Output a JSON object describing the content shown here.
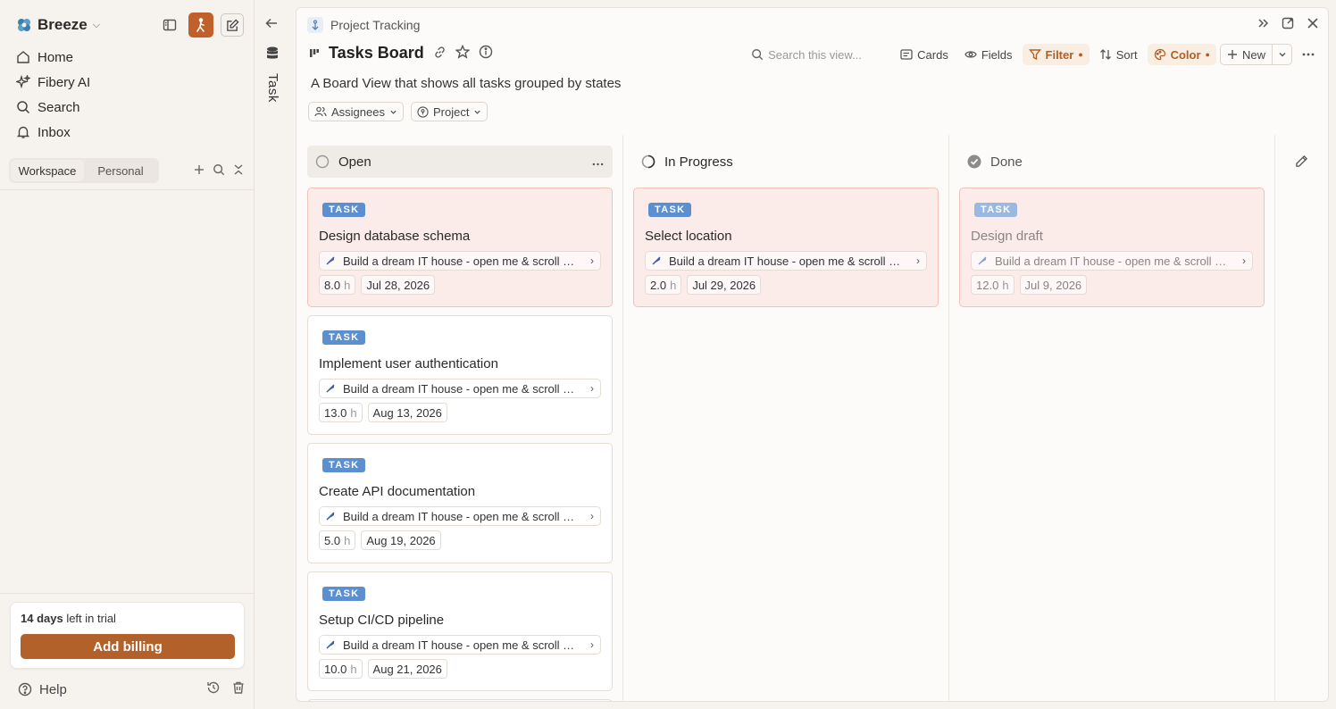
{
  "workspace": {
    "name": "Breeze"
  },
  "nav": [
    {
      "label": "Home",
      "icon": "home-icon"
    },
    {
      "label": "Fibery AI",
      "icon": "sparkle-icon"
    },
    {
      "label": "Search",
      "icon": "search-icon"
    },
    {
      "label": "Inbox",
      "icon": "bell-icon"
    }
  ],
  "sidebar_tabs": {
    "workspace": "Workspace",
    "personal": "Personal"
  },
  "trial": {
    "days": "14 days",
    "suffix": " left in trial",
    "button": "Add billing"
  },
  "help": "Help",
  "strip": {
    "label": "Task"
  },
  "breadcrumb": "Project Tracking",
  "view": {
    "title": "Tasks Board",
    "description": "A Board View that shows all tasks grouped by states",
    "search_placeholder": "Search this view...",
    "toolbar": {
      "cards": "Cards",
      "fields": "Fields",
      "filter": "Filter",
      "sort": "Sort",
      "color": "Color",
      "new": "New"
    },
    "filters": {
      "assignees": "Assignees",
      "project": "Project"
    }
  },
  "columns": [
    {
      "name": "Open",
      "icon": "circle-open-icon"
    },
    {
      "name": "In Progress",
      "icon": "progress-icon"
    },
    {
      "name": "Done",
      "icon": "check-circle-icon"
    }
  ],
  "cards": [
    {
      "badge": "TASK",
      "title": "Design database schema",
      "project": "Build a dream IT house - open me & scroll down",
      "hours": "8.0",
      "unit": "h",
      "date": "Jul 28, 2026"
    },
    {
      "badge": "TASK",
      "title": "Implement user authentication",
      "project": "Build a dream IT house - open me & scroll down",
      "hours": "13.0",
      "unit": "h",
      "date": "Aug 13, 2026"
    },
    {
      "badge": "TASK",
      "title": "Create API documentation",
      "project": "Build a dream IT house - open me & scroll down",
      "hours": "5.0",
      "unit": "h",
      "date": "Aug 19, 2026"
    },
    {
      "badge": "TASK",
      "title": "Setup CI/CD pipeline",
      "project": "Build a dream IT house - open me & scroll down",
      "hours": "10.0",
      "unit": "h",
      "date": "Aug 21, 2026"
    },
    {
      "badge": "TASK",
      "title": "Select location",
      "project": "Build a dream IT house - open me & scroll down",
      "hours": "2.0",
      "unit": "h",
      "date": "Jul 29, 2026"
    },
    {
      "badge": "TASK",
      "title": "Design draft",
      "project": "Build a dream IT house - open me & scroll down",
      "hours": "12.0",
      "unit": "h",
      "date": "Jul 9, 2026"
    }
  ],
  "colors": {
    "brand": "#b3612a",
    "badge": "#5b8fd0",
    "overdue_card": "#fbecea"
  }
}
